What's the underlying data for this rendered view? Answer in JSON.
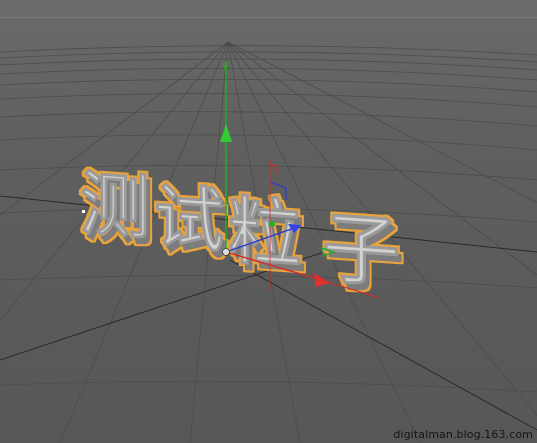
{
  "scene": {
    "text_object": "测试粒子",
    "characters": [
      "测",
      "试",
      "粒",
      "子"
    ],
    "axis_label_y": "Y",
    "selection_color": "#e8a33a",
    "text_color": "#cfcfcf",
    "axis_colors": {
      "x": "#d42a2a",
      "y": "#22b022",
      "z": "#2a3ad4"
    }
  },
  "watermark": "digitalman.blog.163.com"
}
